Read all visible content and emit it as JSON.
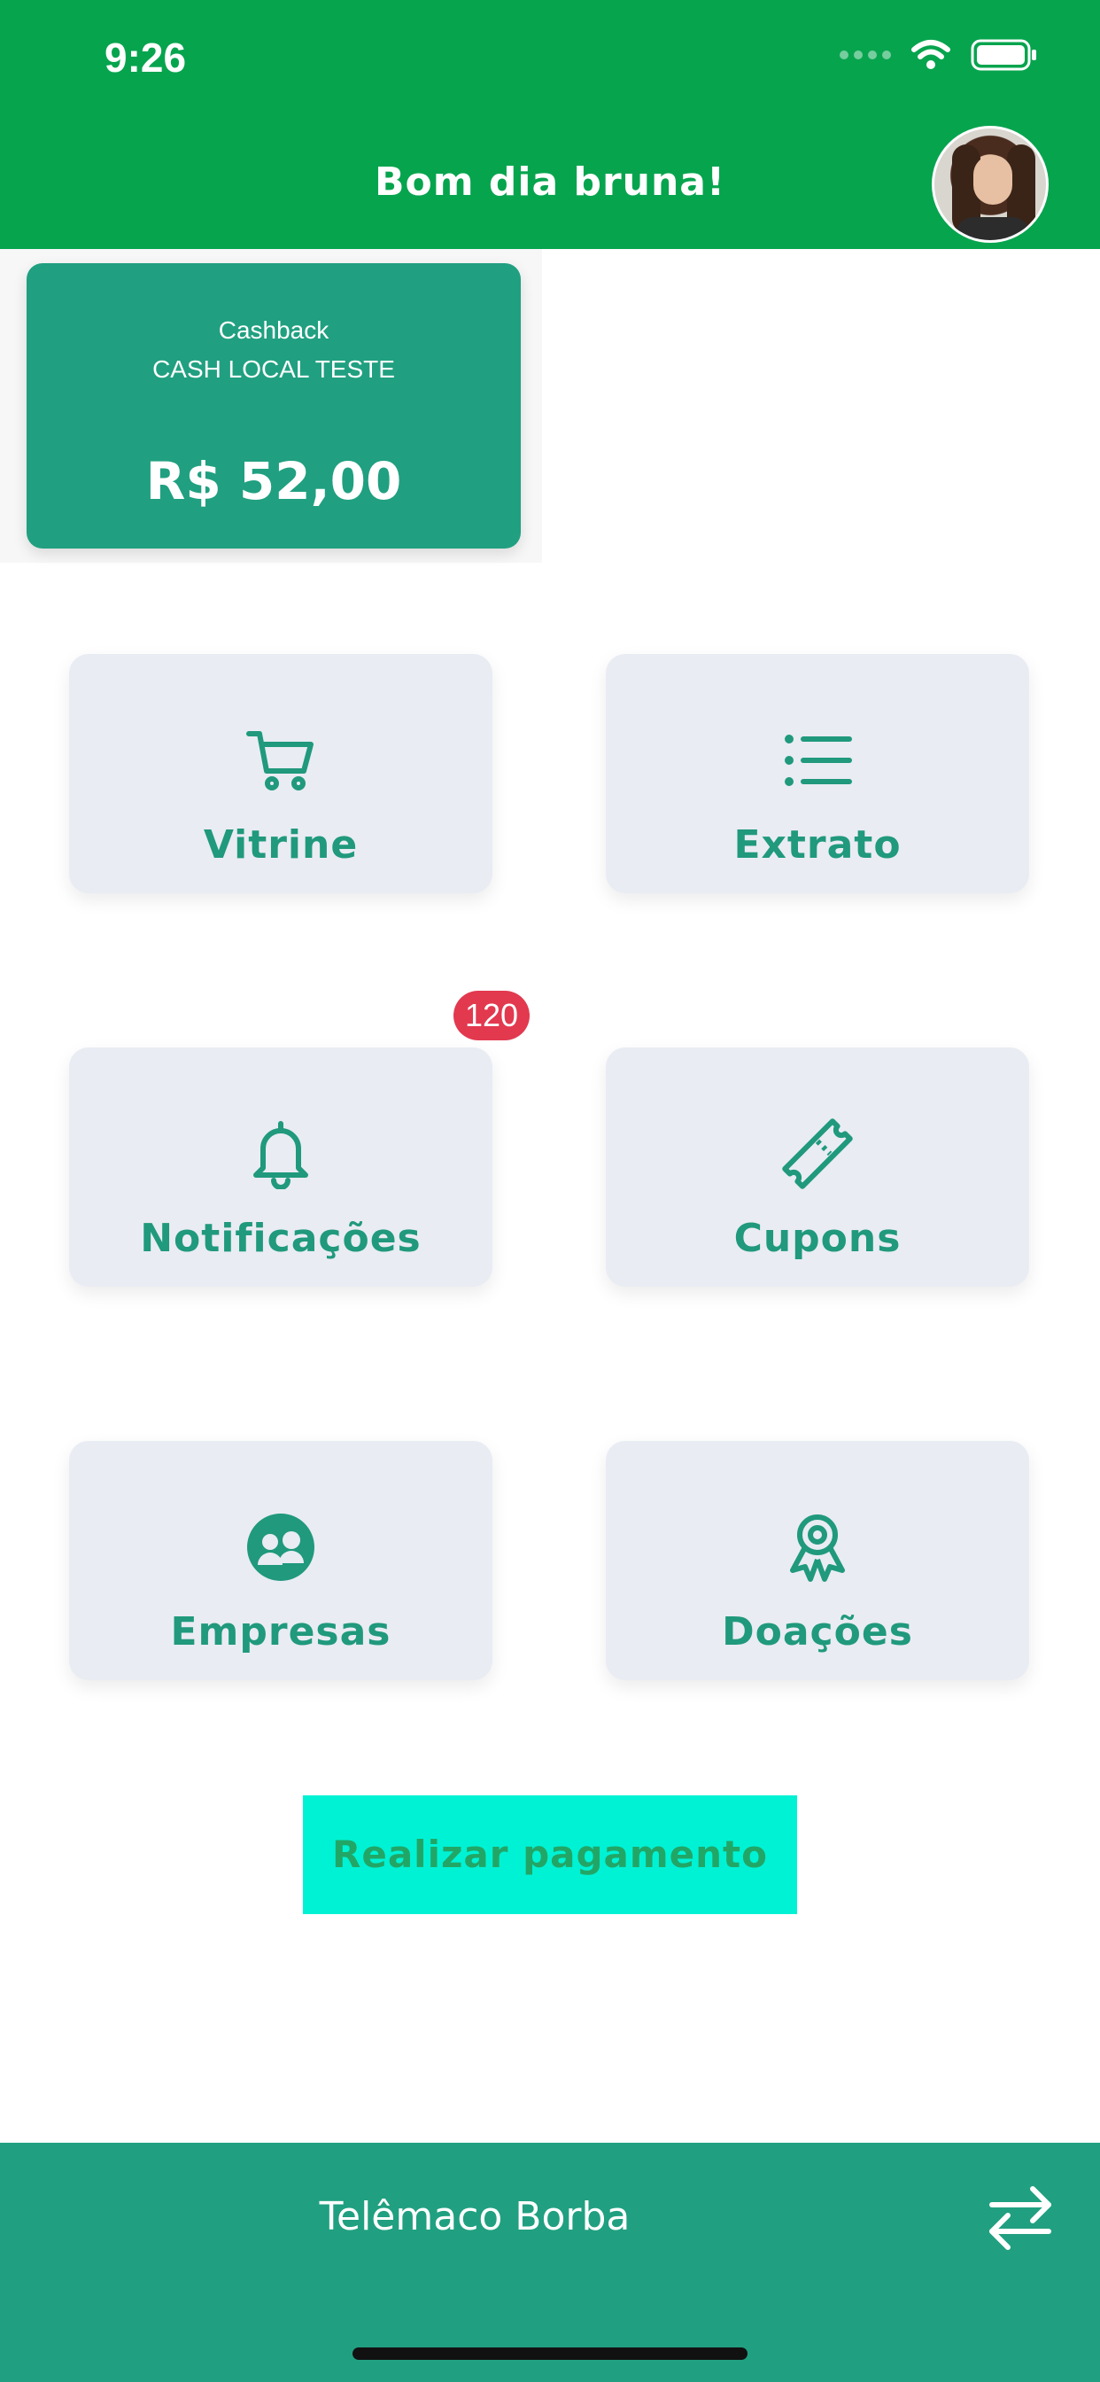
{
  "status_bar": {
    "time": "9:26"
  },
  "header": {
    "greeting": "Bom dia bruna!"
  },
  "cashback_card": {
    "title": "Cashback",
    "subtitle": "CASH LOCAL TESTE",
    "value": "R$ 52,00"
  },
  "tiles": [
    {
      "label": "Vitrine",
      "icon": "cart-icon"
    },
    {
      "label": "Extrato",
      "icon": "list-icon"
    },
    {
      "label": "Notificações",
      "icon": "bell-icon",
      "badge": "120"
    },
    {
      "label": "Cupons",
      "icon": "ticket-icon"
    },
    {
      "label": "Empresas",
      "icon": "users-icon"
    },
    {
      "label": "Doações",
      "icon": "award-icon"
    }
  ],
  "pay_button": {
    "label": "Realizar pagamento"
  },
  "bottom_bar": {
    "city": "Telêmaco Borba",
    "icon": "swap-icon"
  },
  "colors": {
    "header_green": "#07a44e",
    "accent_teal": "#20a080",
    "tile_bg": "#e9ecf3",
    "badge_red": "#e2394f",
    "pay_button_bg": "#00f2d4"
  }
}
